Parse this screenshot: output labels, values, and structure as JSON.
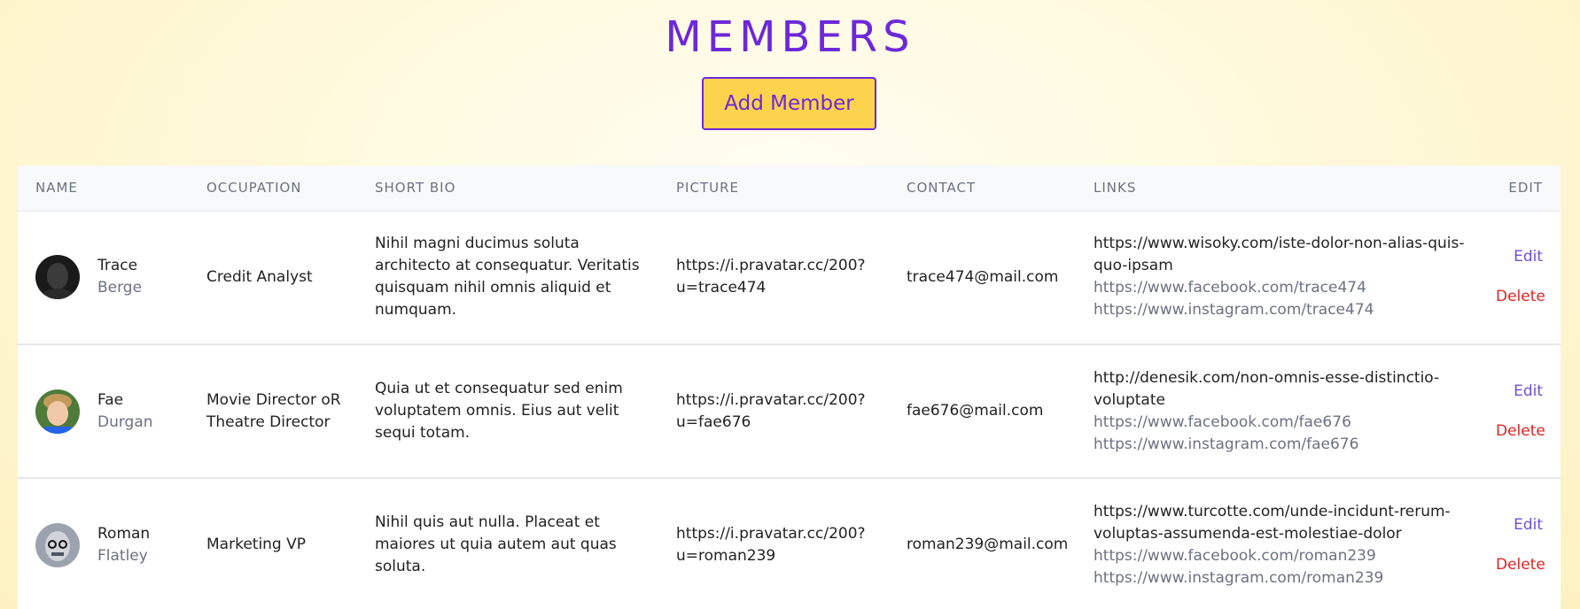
{
  "page": {
    "title": "MEMBERS",
    "add_button": "Add Member"
  },
  "table": {
    "headers": {
      "name": "NAME",
      "occupation": "OCCUPATION",
      "bio": "SHORT BIO",
      "picture": "PICTURE",
      "contact": "CONTACT",
      "links": "LINKS",
      "edit": "EDIT"
    },
    "rows": [
      {
        "first": "Trace",
        "last": "Berge",
        "occupation": "Credit Analyst",
        "bio": "Nihil magni ducimus soluta architecto at consequatur. Veritatis quisquam nihil omnis aliquid et numquam.",
        "picture_a": "https://i.pravatar.cc/200?",
        "picture_b": "u=trace474",
        "contact": "trace474@mail.com",
        "link_site": "https://www.wisoky.com/iste-dolor-non-alias-quis-quo-ipsam",
        "link_facebook": "https://www.facebook.com/trace474",
        "link_instagram": "https://www.instagram.com/trace474",
        "edit": "Edit",
        "delete": "Delete"
      },
      {
        "first": "Fae",
        "last": "Durgan",
        "occupation": "Movie Director oR Theatre Director",
        "bio": "Quia ut et consequatur sed enim voluptatem omnis. Eius aut velit sequi totam.",
        "picture_a": "https://i.pravatar.cc/200?",
        "picture_b": "u=fae676",
        "contact": "fae676@mail.com",
        "link_site": "http://denesik.com/non-omnis-esse-distinctio-voluptate",
        "link_facebook": "https://www.facebook.com/fae676",
        "link_instagram": "https://www.instagram.com/fae676",
        "edit": "Edit",
        "delete": "Delete"
      },
      {
        "first": "Roman",
        "last": "Flatley",
        "occupation": "Marketing VP",
        "bio": "Nihil quis aut nulla. Placeat et maiores ut quia autem aut quas soluta.",
        "picture_a": "https://i.pravatar.cc/200?",
        "picture_b": "u=roman239",
        "contact": "roman239@mail.com",
        "link_site": "https://www.turcotte.com/unde-incidunt-rerum-voluptas-assumenda-est-molestiae-dolor",
        "link_facebook": "https://www.facebook.com/roman239",
        "link_instagram": "https://www.instagram.com/roman239",
        "edit": "Edit",
        "delete": "Delete"
      }
    ]
  },
  "colors": {
    "accent": "#6d28d9",
    "button_bg": "#fcd34d",
    "delete": "#dc2626",
    "edit": "#6d4fd9"
  }
}
